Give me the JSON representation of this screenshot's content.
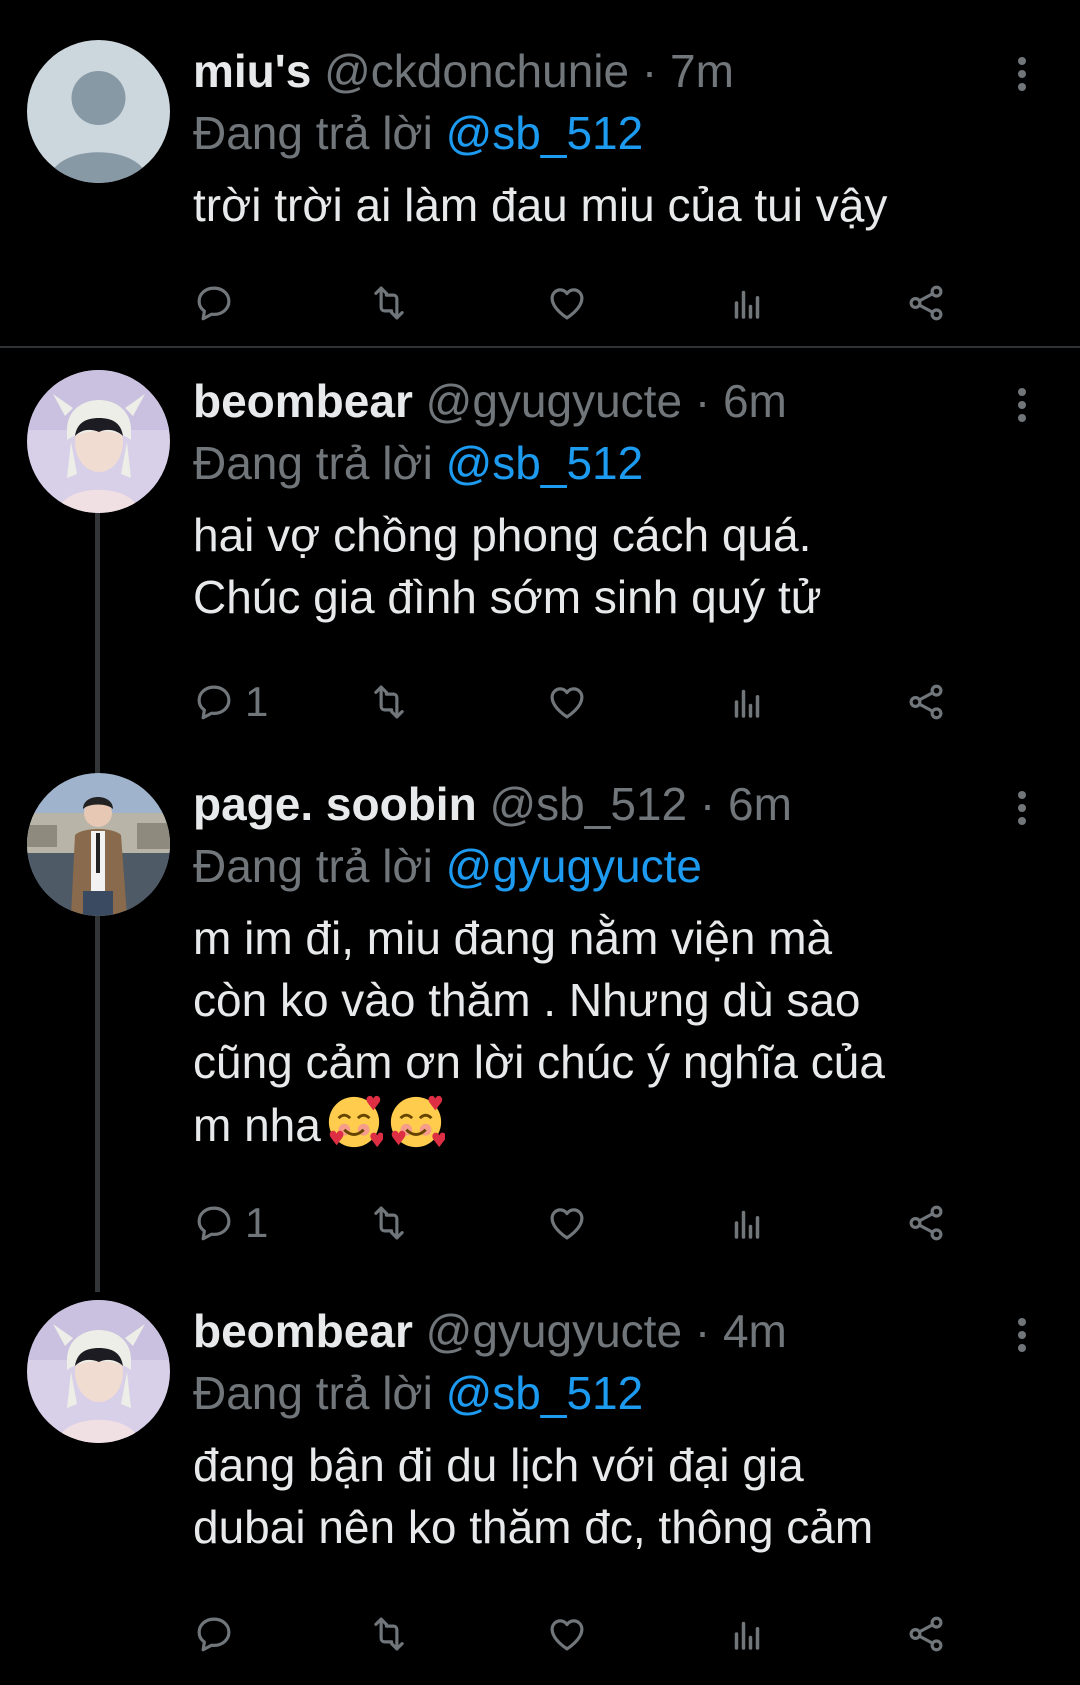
{
  "tweets": [
    {
      "name": "miu's",
      "handle": "@ckdonchunie",
      "sep": "·",
      "time": "7m",
      "reply_prefix": "Đang trả lời",
      "reply_to": "@sb_512",
      "lines": [
        "trời trời ai làm đau miu của tui vậy"
      ],
      "reply_count": ""
    },
    {
      "name": "beombear",
      "handle": "@gyugyucte",
      "sep": "·",
      "time": "6m",
      "reply_prefix": "Đang trả lời",
      "reply_to": "@sb_512",
      "lines": [
        "hai vợ chồng phong cách quá.",
        "Chúc gia đình sớm sinh quý tử"
      ],
      "reply_count": "1"
    },
    {
      "name": "page. soobin",
      "handle": "@sb_512",
      "sep": "·",
      "time": "6m",
      "reply_prefix": "Đang trả lời",
      "reply_to": "@gyugyucte",
      "lines": [
        "m im đi, miu đang nằm viện mà",
        "còn ko vào thăm . Nhưng dù sao",
        "cũng cảm ơn lời chúc ý nghĩa của",
        "m nha"
      ],
      "emoji": "smiling-face-with-hearts",
      "reply_count": "1"
    },
    {
      "name": "beombear",
      "handle": "@gyugyucte",
      "sep": "·",
      "time": "4m",
      "reply_prefix": "Đang trả lời",
      "reply_to": "@sb_512",
      "lines": [
        "đang bận đi du lịch với đại gia",
        "dubai nên ko thăm đc, thông cảm"
      ],
      "reply_count": ""
    }
  ],
  "icons": {
    "reply": "reply-icon",
    "retweet": "retweet-icon",
    "like": "heart-icon",
    "views": "analytics-icon",
    "share": "share-icon",
    "more": "more-dots-icon"
  },
  "colors": {
    "background": "#000000",
    "text": "#e7e9ea",
    "muted": "#71767b",
    "mention": "#1d9bf0",
    "divider": "#2f3336"
  }
}
